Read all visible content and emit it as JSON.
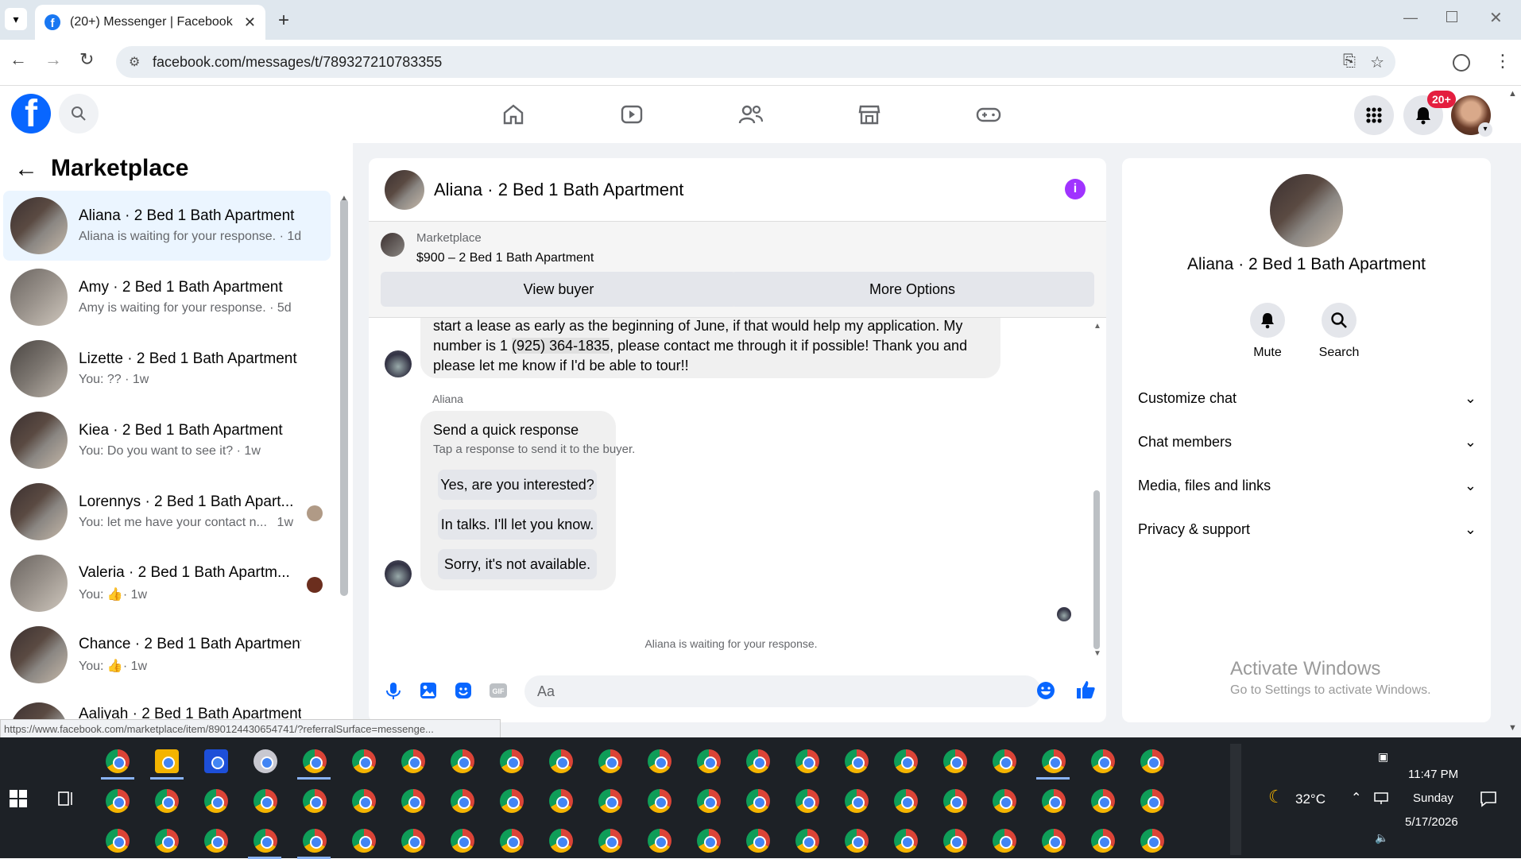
{
  "browser": {
    "tab_title": "(20+) Messenger | Facebook",
    "url": "facebook.com/messages/t/789327210783355"
  },
  "fb": {
    "notifications_badge": "20+"
  },
  "left": {
    "title": "Marketplace",
    "conversations": [
      {
        "name": "Aliana · 2 Bed 1 Bath Apartment",
        "sub": "Aliana is waiting for your response. · 1d",
        "active": true
      },
      {
        "name": "Amy · 2 Bed 1 Bath Apartment",
        "sub": "Amy is waiting for your response. · 5d"
      },
      {
        "name": "Lizette · 2 Bed 1 Bath Apartment",
        "sub": "You: ?? · 1w"
      },
      {
        "name": "Kiea · 2 Bed 1 Bath Apartment",
        "sub": "You: Do you want to see it? · 1w"
      },
      {
        "name": "Lorennys · 2 Bed 1 Bath Apart...",
        "sub": "You: let me have your contact n...",
        "time": "1w"
      },
      {
        "name": "Valeria · 2 Bed 1 Bath Apartm...",
        "sub": "You: ",
        "time": "· 1w"
      },
      {
        "name": "Chance · 2 Bed 1 Bath Apartment",
        "sub": "You: ",
        "time": "· 1w"
      },
      {
        "name": "Aaliyah · 2 Bed 1 Bath Apartment",
        "sub": ""
      }
    ]
  },
  "chat": {
    "title": "Aliana · 2 Bed 1 Bath Apartment",
    "marketplace_label": "Marketplace",
    "listing": "$900 – 2 Bed 1 Bath Apartment",
    "view_buyer": "View buyer",
    "more_options": "More Options",
    "message_line1": "start a lease as early as the beginning of June, if that would help my application. My",
    "message_line2_pre": "number is 1 ",
    "message_phone": "(925) 364-1835",
    "message_line2_post": ", please contact me through it if possible! Thank you and",
    "message_line3": "please let me know if I'd be able to tour!!",
    "sender": "Aliana",
    "quick_title": "Send a quick response",
    "quick_sub": "Tap a response to send it to the buyer.",
    "quick_responses": [
      "Yes, are you interested?",
      "In talks. I'll let you know.",
      "Sorry, it's not available."
    ],
    "waiting": "Aliana is waiting for your response.",
    "composer_placeholder": "Aa"
  },
  "right": {
    "name": "Aliana · 2 Bed 1 Bath Apartment",
    "mute": "Mute",
    "search": "Search",
    "sections": [
      "Customize chat",
      "Chat members",
      "Media, files and links",
      "Privacy & support"
    ]
  },
  "windows": {
    "activate_title": "Activate Windows",
    "activate_sub": "Go to Settings to activate Windows.",
    "status_url": "https://www.facebook.com/marketplace/item/890124430654741/?referralSurface=messenge..."
  },
  "tray": {
    "temp": "32°C",
    "time": "11:47 PM",
    "day": "Sunday",
    "date": "5/17/2026"
  }
}
